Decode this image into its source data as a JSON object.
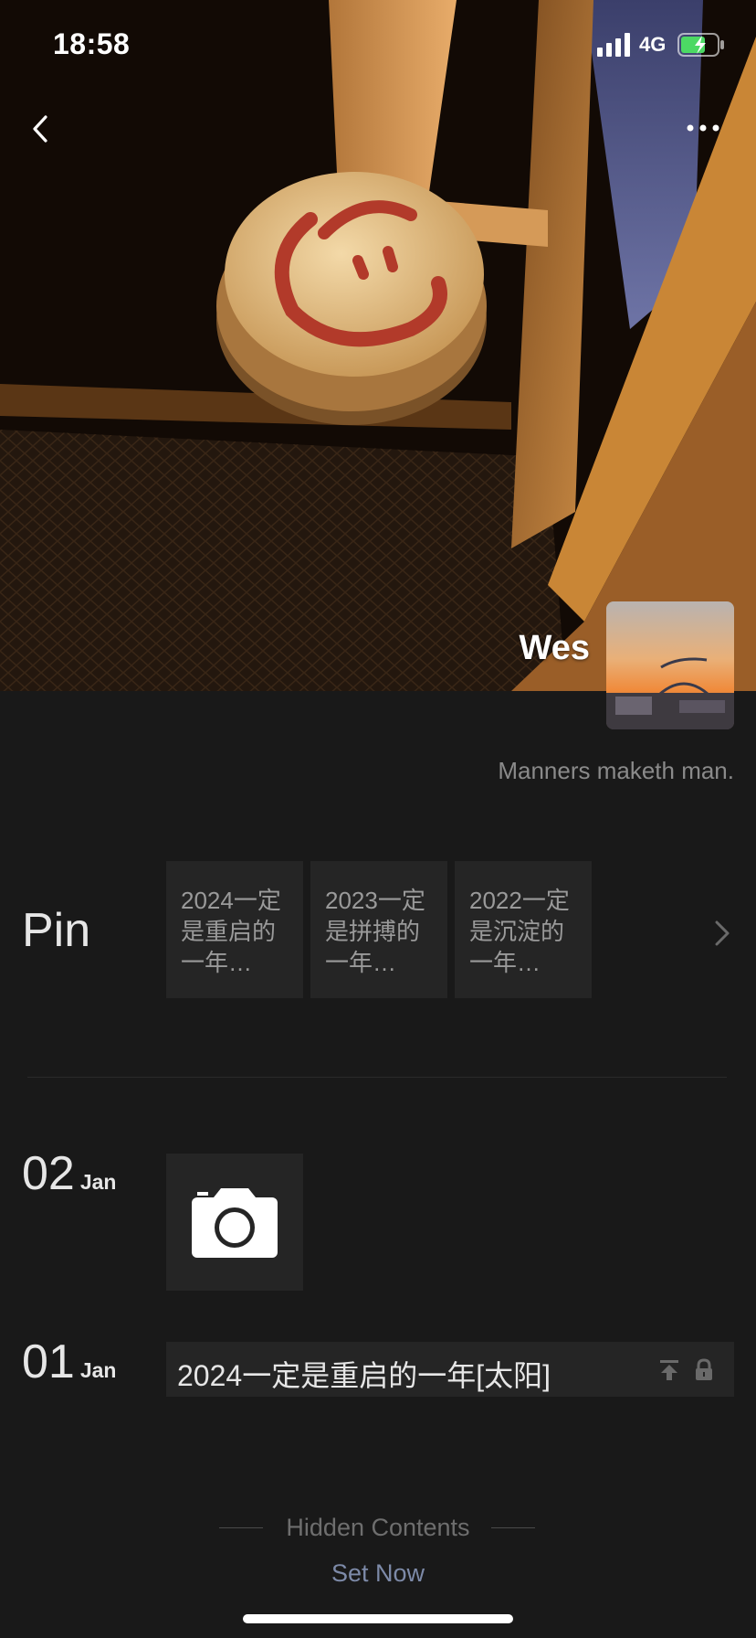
{
  "status_bar": {
    "time": "18:58",
    "network": "4G"
  },
  "nav": {
    "back_icon": "chevron-left-icon",
    "more_icon": "ellipsis-icon"
  },
  "profile": {
    "name": "Wes",
    "signature": "Manners maketh man."
  },
  "pin": {
    "label": "Pin",
    "items": [
      {
        "text": "2024一定是重启的一年…"
      },
      {
        "text": "2023一定是拼搏的一年…"
      },
      {
        "text": "2022一定是沉淀的一年…"
      }
    ]
  },
  "moments": [
    {
      "day": "02",
      "month": "Jan",
      "type": "camera"
    },
    {
      "day": "01",
      "month": "Jan",
      "type": "text",
      "text": "2024一定是重启的一年[太阳]",
      "icons": [
        "pin-top-icon",
        "lock-icon"
      ]
    }
  ],
  "footer": {
    "hidden_label": "Hidden Contents",
    "set_now": "Set Now"
  },
  "colors": {
    "background": "#191919",
    "card": "#252525",
    "link": "#7d8aa8"
  }
}
